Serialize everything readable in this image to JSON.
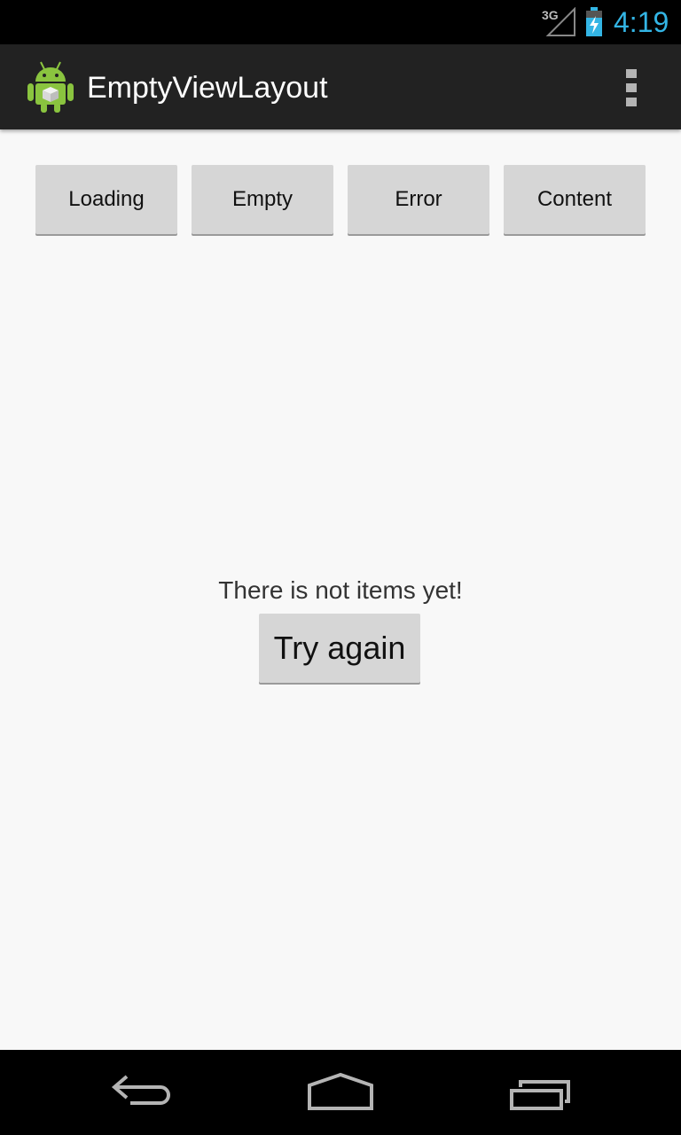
{
  "status_bar": {
    "network": "3G",
    "time": "4:19",
    "icons": [
      "signal-icon",
      "battery-charging-icon"
    ]
  },
  "action_bar": {
    "title": "EmptyViewLayout",
    "icons": [
      "android-app-icon",
      "overflow-menu-icon"
    ]
  },
  "buttons": [
    {
      "label": "Loading"
    },
    {
      "label": "Empty"
    },
    {
      "label": "Error"
    },
    {
      "label": "Content"
    }
  ],
  "empty_state": {
    "message": "There is not items yet!",
    "retry_label": "Try again"
  },
  "nav_bar": {
    "icons": [
      "back-icon",
      "home-icon",
      "recent-apps-icon"
    ]
  },
  "colors": {
    "status_accent": "#33b5e5",
    "action_bar": "#222222",
    "background": "#f8f8f8",
    "button": "#d6d6d6"
  }
}
